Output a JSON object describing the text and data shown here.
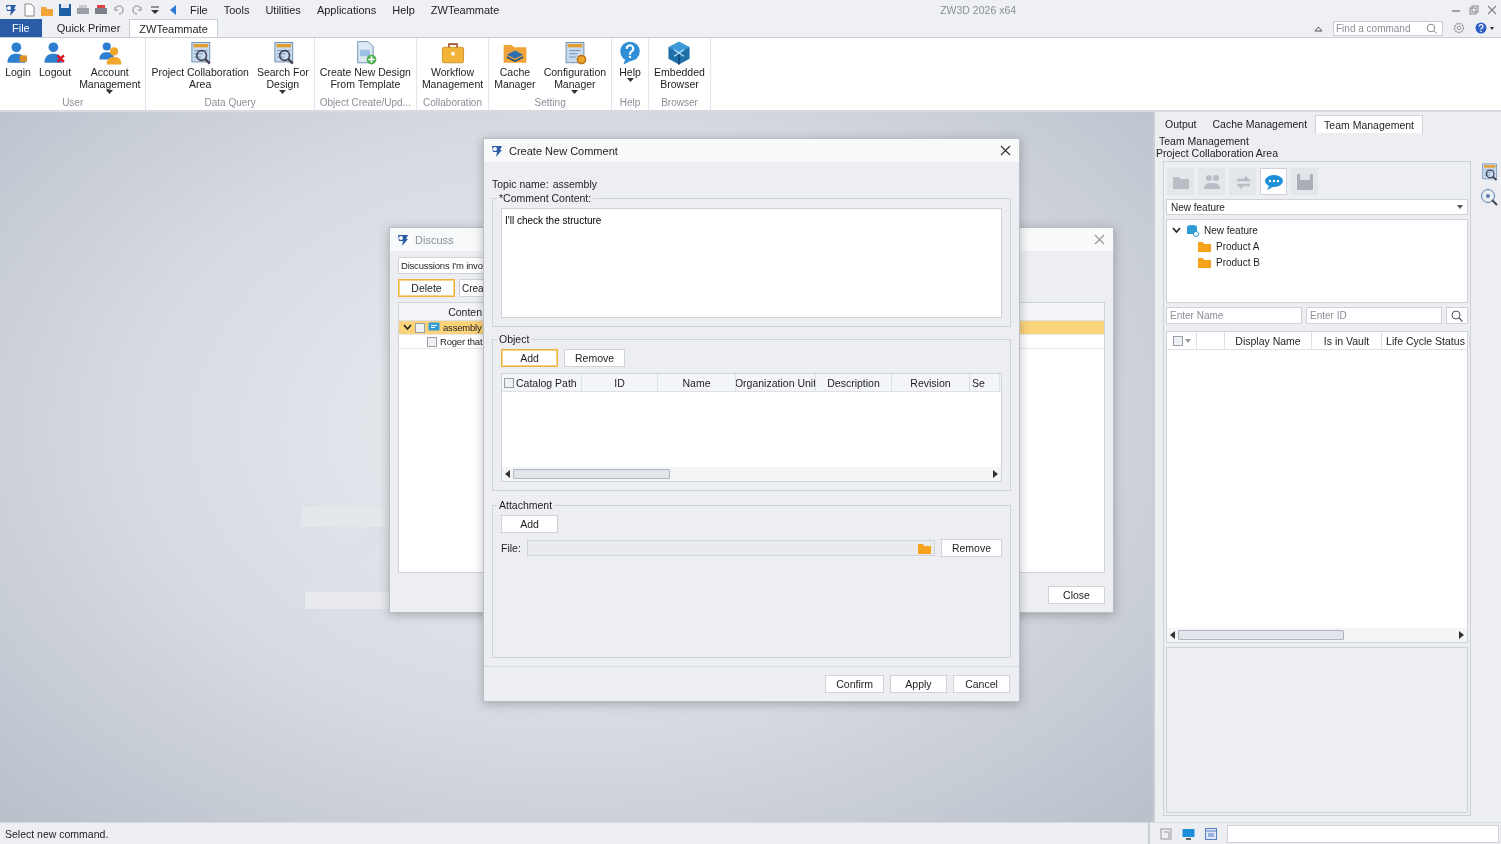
{
  "app": {
    "title": "ZW3D 2026 x64",
    "menu": [
      "File",
      "Tools",
      "Utilities",
      "Applications",
      "Help",
      "ZWTeammate"
    ],
    "search": {
      "placeholder": "Find a command"
    }
  },
  "ribbon_tabs": [
    {
      "label": "File",
      "kind": "file",
      "selected": false
    },
    {
      "label": "Quick Primer",
      "kind": "tab",
      "selected": false
    },
    {
      "label": "ZWTeammate",
      "kind": "tab",
      "selected": true
    }
  ],
  "ribbon_groups": [
    {
      "label": "User",
      "commands": [
        {
          "label": "Login",
          "dropdown": false
        },
        {
          "label": "Logout",
          "dropdown": false
        },
        {
          "label": "Account\nManagement",
          "dropdown": true
        }
      ]
    },
    {
      "label": "Data Query",
      "commands": [
        {
          "label": "Project Collaboration\nArea",
          "dropdown": false
        },
        {
          "label": "Search For\nDesign",
          "dropdown": true
        }
      ]
    },
    {
      "label": "Object Create/Upd...",
      "commands": [
        {
          "label": "Create New Design\nFrom Template",
          "dropdown": false
        }
      ]
    },
    {
      "label": "Collaboration",
      "commands": [
        {
          "label": "Workflow\nManagement",
          "dropdown": false
        }
      ]
    },
    {
      "label": "Setting",
      "commands": [
        {
          "label": "Cache\nManager",
          "dropdown": false
        },
        {
          "label": "Configuration\nManager",
          "dropdown": true
        }
      ]
    },
    {
      "label": "Help",
      "commands": [
        {
          "label": "Help",
          "dropdown": true
        }
      ]
    },
    {
      "label": "Browser",
      "commands": [
        {
          "label": "Embedded\nBrowser",
          "dropdown": false
        }
      ]
    }
  ],
  "discuss_dialog": {
    "title": "Discuss",
    "filter": "Discussions I'm invo",
    "buttons": [
      {
        "label": "Delete",
        "focused": true
      },
      {
        "label": "Crea",
        "focused": false
      }
    ],
    "column": "Conten",
    "tree": [
      {
        "label": "assembly",
        "expanded": true,
        "selected": true,
        "children": [
          {
            "label": "Roger that",
            "selected": false
          }
        ]
      }
    ],
    "close": "Close"
  },
  "comment_dialog": {
    "title": "Create New Comment",
    "topic_label": "Topic name:",
    "topic_value": "assembly",
    "content_label": "*Comment Content:",
    "content_value": "I'll check the structure",
    "object": {
      "label": "Object",
      "buttons": [
        {
          "label": "Add",
          "focused": true
        },
        {
          "label": "Remove",
          "focused": false
        }
      ],
      "columns": [
        "Catalog Path",
        "ID",
        "Name",
        "Organization Unit",
        "Description",
        "Revision",
        "Se"
      ]
    },
    "attachment": {
      "label": "Attachment",
      "add": "Add",
      "file_label": "File:",
      "remove": "Remove"
    },
    "buttons": [
      "Confirm",
      "Apply",
      "Cancel"
    ]
  },
  "side_panel": {
    "tabs": [
      {
        "label": "Output",
        "selected": false
      },
      {
        "label": "Cache Management",
        "selected": false
      },
      {
        "label": "Team Management",
        "selected": true
      }
    ],
    "title": "Team Management",
    "subtitle": "Project Collaboration Area",
    "tools": [
      {
        "selected": false
      },
      {
        "selected": false
      },
      {
        "selected": false
      },
      {
        "selected": true
      },
      {
        "selected": false
      }
    ],
    "project": "New feature",
    "tree": [
      {
        "label": "New feature",
        "expanded": true,
        "children": [
          {
            "label": "Product A"
          },
          {
            "label": "Product B"
          }
        ]
      }
    ],
    "name_field": {
      "placeholder": "Enter Name"
    },
    "id_field": {
      "placeholder": "Enter ID"
    },
    "columns": [
      "Display Name",
      "Is in Vault",
      "Life Cycle Status"
    ]
  },
  "status_bar": {
    "message": "Select new command."
  }
}
